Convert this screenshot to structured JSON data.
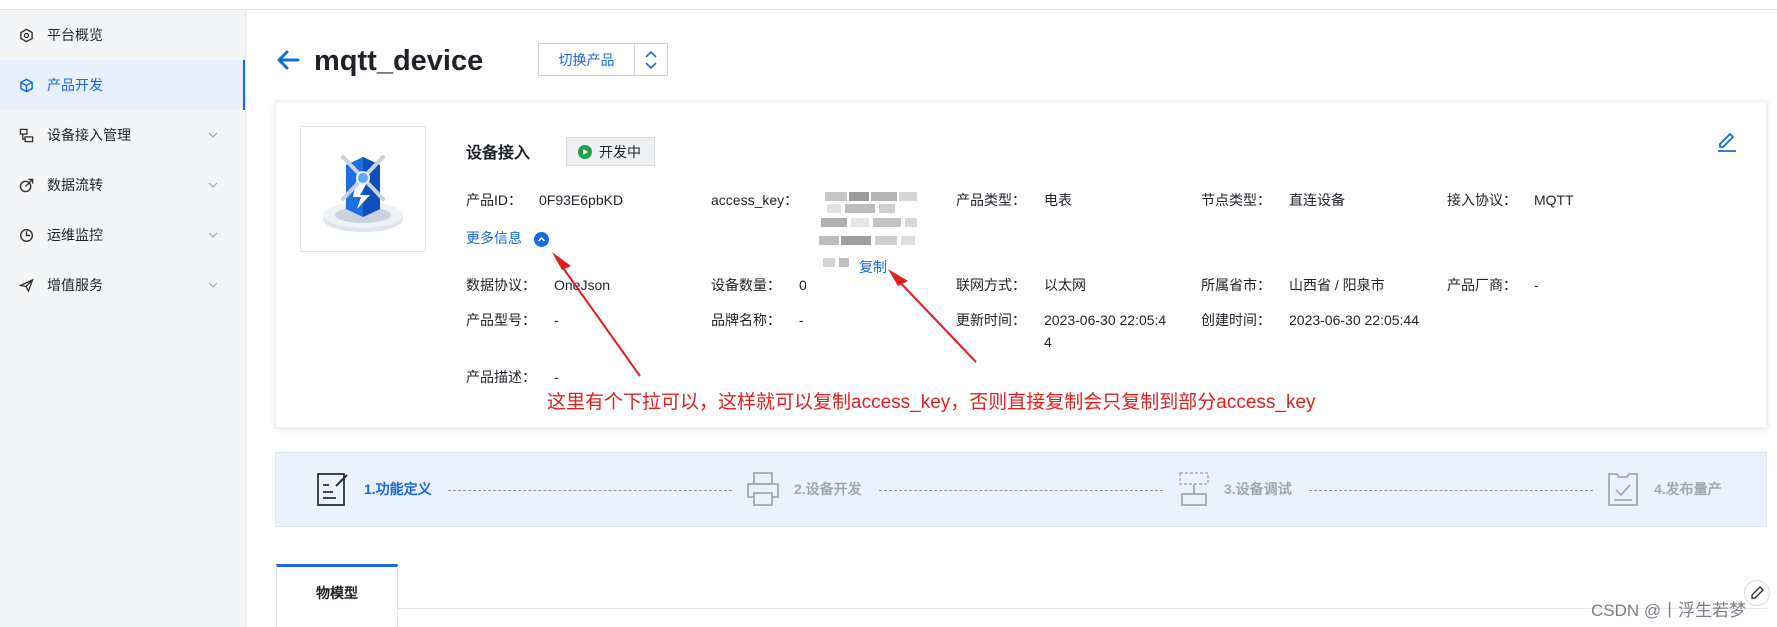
{
  "sidebar": {
    "items": [
      {
        "label": "平台概览",
        "icon": "hexagon-icon",
        "expandable": false,
        "active": false
      },
      {
        "label": "产品开发",
        "icon": "cube-icon",
        "expandable": false,
        "active": true
      },
      {
        "label": "设备接入管理",
        "icon": "device-access-icon",
        "expandable": true,
        "active": false
      },
      {
        "label": "数据流转",
        "icon": "data-flow-icon",
        "expandable": true,
        "active": false
      },
      {
        "label": "运维监控",
        "icon": "monitor-icon",
        "expandable": true,
        "active": false
      },
      {
        "label": "增值服务",
        "icon": "send-icon",
        "expandable": true,
        "active": false
      }
    ]
  },
  "header": {
    "title": "mqtt_device",
    "switch_label": "切换产品"
  },
  "product": {
    "section_title": "设备接入",
    "status": "开发中",
    "more_info": "更多信息",
    "copy_label": "复制",
    "fields": {
      "product_id": {
        "label": "产品ID：",
        "value": "0F93E6pbKD"
      },
      "access_key": {
        "label": "access_key：",
        "value": ""
      },
      "product_type": {
        "label": "产品类型：",
        "value": "电表"
      },
      "node_type": {
        "label": "节点类型：",
        "value": "直连设备"
      },
      "protocol": {
        "label": "接入协议：",
        "value": "MQTT"
      },
      "data_protocol": {
        "label": "数据协议：",
        "value": "OneJson"
      },
      "device_count": {
        "label": "设备数量：",
        "value": "0"
      },
      "network": {
        "label": "联网方式：",
        "value": "以太网"
      },
      "region": {
        "label": "所属省市：",
        "value": "山西省 / 阳泉市"
      },
      "vendor": {
        "label": "产品厂商：",
        "value": "-"
      },
      "model": {
        "label": "产品型号：",
        "value": "-"
      },
      "brand": {
        "label": "品牌名称：",
        "value": "-"
      },
      "updated": {
        "label": "更新时间：",
        "value_line1": "2023-06-30 22:05:4",
        "value_line2": "4"
      },
      "created": {
        "label": "创建时间：",
        "value": "2023-06-30 22:05:44"
      },
      "description": {
        "label": "产品描述：",
        "value": "-"
      }
    }
  },
  "annotation": "这里有个下拉可以，这样就可以复制access_key，否则直接复制会只复制到部分access_key",
  "steps": [
    {
      "label": "1.功能定义",
      "active": true
    },
    {
      "label": "2.设备开发",
      "active": false
    },
    {
      "label": "3.设备调试",
      "active": false
    },
    {
      "label": "4.发布量产",
      "active": false
    }
  ],
  "tabs": [
    {
      "label": "物模型"
    }
  ],
  "watermark": "CSDN @丨浮生若梦",
  "colors": {
    "accent": "#1768e4",
    "status_green": "#1aa34a",
    "annotation_red": "#e02020"
  }
}
